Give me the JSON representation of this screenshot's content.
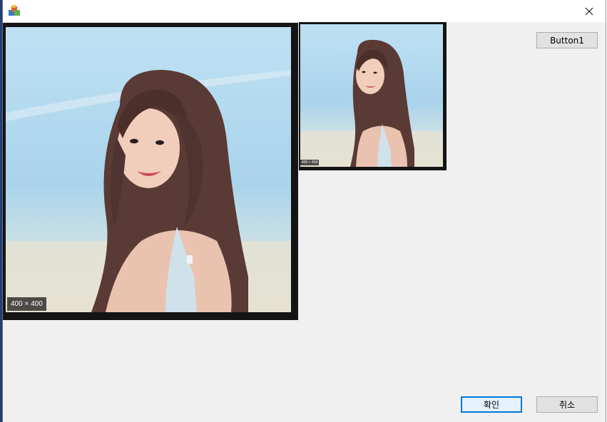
{
  "window": {
    "title": "",
    "icon": "app-icon",
    "close_icon": "close-icon"
  },
  "images": {
    "large": {
      "dimension_label": "400 × 400",
      "subject": "portrait-photo"
    },
    "small": {
      "dimension_label": "400 × 400",
      "subject": "portrait-photo"
    }
  },
  "buttons": {
    "button1": "Button1",
    "ok": "확인",
    "cancel": "취소"
  },
  "colors": {
    "accent": "#0078d7",
    "dialog_background": "#f0f0f0",
    "frame": "#141414"
  }
}
